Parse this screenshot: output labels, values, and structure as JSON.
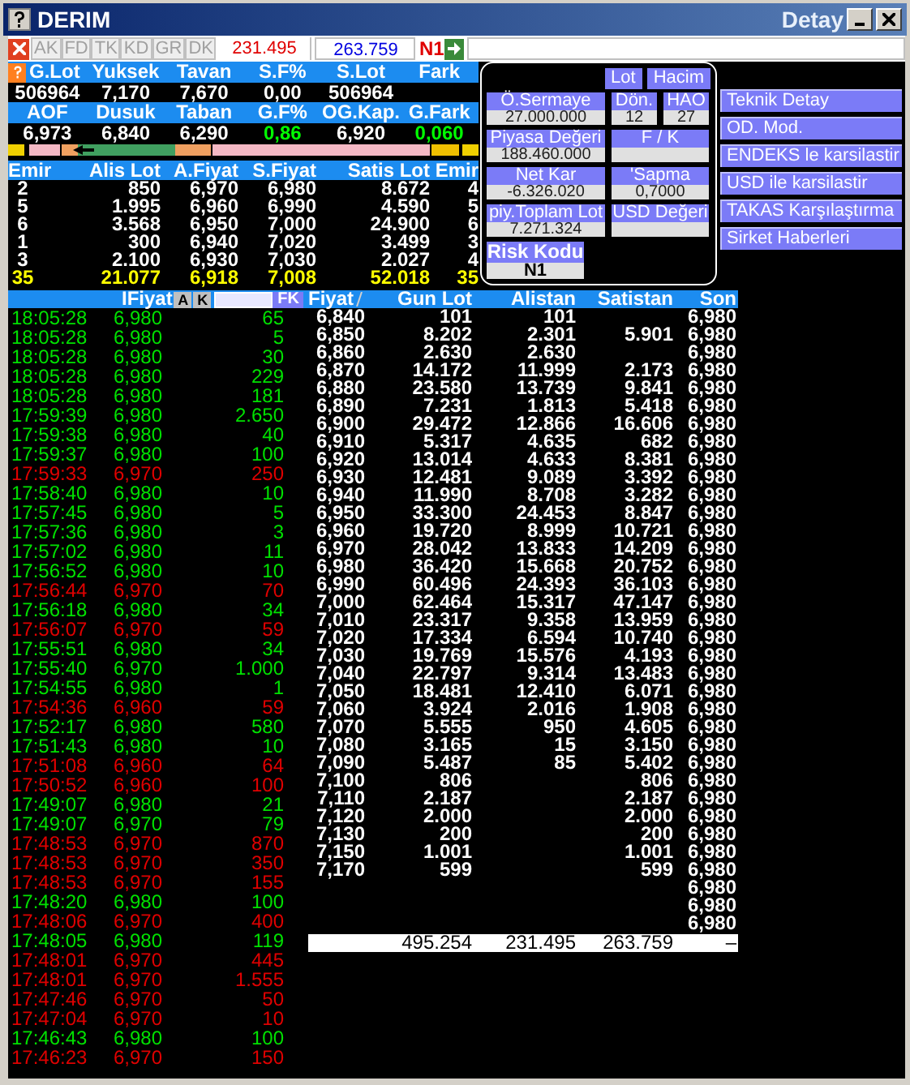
{
  "window": {
    "title": "DERIM",
    "subtitle": "Detay"
  },
  "toolbar": {
    "buttons": [
      {
        "label": "AK",
        "disabled": true
      },
      {
        "label": "FD",
        "disabled": true
      },
      {
        "label": "TK",
        "disabled": true
      },
      {
        "label": "KD",
        "disabled": true
      },
      {
        "label": "GR",
        "disabled": true
      },
      {
        "label": "DK",
        "disabled": true
      }
    ],
    "buy_total": "231.495",
    "sell_total": "263.759",
    "risk": "N1"
  },
  "stats_top": [
    {
      "label": "G.Lot",
      "value": "506964"
    },
    {
      "label": "Yuksek",
      "value": "7,170"
    },
    {
      "label": "Tavan",
      "value": "7,670"
    },
    {
      "label": "S.F%",
      "value": "0,00"
    },
    {
      "label": "S.Lot",
      "value": "506964"
    },
    {
      "label": "Fark"
    }
  ],
  "stats_bottom": [
    {
      "label": "AOF",
      "value": "6,973"
    },
    {
      "label": "Dusuk",
      "value": "6,840"
    },
    {
      "label": "Taban",
      "value": "6,290"
    },
    {
      "label": "G.F%",
      "value": "0,86",
      "color": "#00ff00"
    },
    {
      "label": "OG.Kap.",
      "value": "6,920"
    },
    {
      "label": "G.Fark",
      "value": "0,060",
      "color": "#00ff00"
    }
  ],
  "depth": {
    "columns": [
      "Emir",
      "Alis Lot",
      "A.Fiyat",
      "S.Fiyat",
      "Satis Lot",
      "Emir"
    ],
    "rows": [
      [
        "2",
        "850",
        "6,970",
        "6,980",
        "8.672",
        "4"
      ],
      [
        "5",
        "1.995",
        "6,960",
        "6,990",
        "4.590",
        "5"
      ],
      [
        "6",
        "3.568",
        "6,950",
        "7,000",
        "24.900",
        "6"
      ],
      [
        "1",
        "300",
        "6,940",
        "7,020",
        "3.499",
        "3"
      ],
      [
        "3",
        "2.100",
        "6,930",
        "7,030",
        "2.027",
        "4"
      ]
    ],
    "totals": [
      "35",
      "21.077",
      "6,918",
      "7,008",
      "52.018",
      "35"
    ]
  },
  "detail": {
    "toggles": [
      "Lot",
      "Hacim"
    ],
    "rows": [
      [
        {
          "label": "Ö.Sermaye",
          "value": "27.000.000"
        },
        {
          "label": "Dön.",
          "value": "12"
        },
        {
          "label": "HAO",
          "value": "27"
        }
      ],
      [
        {
          "label": "Piyasa Değeri",
          "value": "188.460.000"
        },
        {
          "label": "F / K"
        }
      ],
      [
        {
          "label": "Net Kar",
          "value": "-6.326.020"
        },
        {
          "label": "'Sapma",
          "value": "0,7000"
        }
      ],
      [
        {
          "label": "piy.Toplam Lot",
          "value": "7.271.324"
        },
        {
          "label": "USD Değeri"
        }
      ]
    ],
    "risk": {
      "label": "Risk Kodu",
      "value": "N1"
    }
  },
  "links": [
    "Teknik Detay",
    "OD. Mod.",
    "ENDEKS le karsilastir",
    "USD ile karsilastir",
    "TAKAS Karşılaştırma",
    "Sirket Haberleri"
  ],
  "trades": {
    "header": "IFiyat",
    "buttons": [
      "A",
      "K"
    ],
    "filter_button": "FK",
    "rows": [
      {
        "time": "18:05:28",
        "price": "6,980",
        "lot": "65",
        "color": "#00e000"
      },
      {
        "time": "18:05:28",
        "price": "6,980",
        "lot": "5",
        "color": "#00e000"
      },
      {
        "time": "18:05:28",
        "price": "6,980",
        "lot": "30",
        "color": "#00e000"
      },
      {
        "time": "18:05:28",
        "price": "6,980",
        "lot": "229",
        "color": "#00e000"
      },
      {
        "time": "18:05:28",
        "price": "6,980",
        "lot": "181",
        "color": "#00e000"
      },
      {
        "time": "17:59:39",
        "price": "6,980",
        "lot": "2.650",
        "color": "#00e000"
      },
      {
        "time": "17:59:38",
        "price": "6,980",
        "lot": "40",
        "color": "#00e000"
      },
      {
        "time": "17:59:37",
        "price": "6,980",
        "lot": "100",
        "color": "#00e000"
      },
      {
        "time": "17:59:33",
        "price": "6,970",
        "lot": "250",
        "color": "#e00000"
      },
      {
        "time": "17:58:40",
        "price": "6,980",
        "lot": "10",
        "color": "#00e000"
      },
      {
        "time": "17:57:45",
        "price": "6,980",
        "lot": "5",
        "color": "#00e000"
      },
      {
        "time": "17:57:36",
        "price": "6,980",
        "lot": "3",
        "color": "#00e000"
      },
      {
        "time": "17:57:02",
        "price": "6,980",
        "lot": "11",
        "color": "#00e000"
      },
      {
        "time": "17:56:52",
        "price": "6,980",
        "lot": "10",
        "color": "#00e000"
      },
      {
        "time": "17:56:44",
        "price": "6,970",
        "lot": "70",
        "color": "#e00000"
      },
      {
        "time": "17:56:18",
        "price": "6,980",
        "lot": "34",
        "color": "#00e000"
      },
      {
        "time": "17:56:07",
        "price": "6,970",
        "lot": "59",
        "color": "#e00000"
      },
      {
        "time": "17:55:51",
        "price": "6,980",
        "lot": "34",
        "color": "#00e000"
      },
      {
        "time": "17:55:40",
        "price": "6,970",
        "lot": "1.000",
        "color": "#00e000"
      },
      {
        "time": "17:54:55",
        "price": "6,980",
        "lot": "1",
        "color": "#00e000"
      },
      {
        "time": "17:54:36",
        "price": "6,960",
        "lot": "59",
        "color": "#e00000"
      },
      {
        "time": "17:52:17",
        "price": "6,980",
        "lot": "580",
        "color": "#00e000"
      },
      {
        "time": "17:51:43",
        "price": "6,980",
        "lot": "10",
        "color": "#00e000"
      },
      {
        "time": "17:51:08",
        "price": "6,960",
        "lot": "64",
        "color": "#e00000"
      },
      {
        "time": "17:50:52",
        "price": "6,960",
        "lot": "100",
        "color": "#e00000"
      },
      {
        "time": "17:49:07",
        "price": "6,980",
        "lot": "21",
        "color": "#00e000"
      },
      {
        "time": "17:49:07",
        "price": "6,970",
        "lot": "79",
        "color": "#00e000"
      },
      {
        "time": "17:48:53",
        "price": "6,970",
        "lot": "870",
        "color": "#e00000"
      },
      {
        "time": "17:48:53",
        "price": "6,970",
        "lot": "350",
        "color": "#e00000"
      },
      {
        "time": "17:48:53",
        "price": "6,970",
        "lot": "155",
        "color": "#e00000"
      },
      {
        "time": "17:48:20",
        "price": "6,980",
        "lot": "100",
        "color": "#00e000"
      },
      {
        "time": "17:48:06",
        "price": "6,970",
        "lot": "400",
        "color": "#e00000"
      },
      {
        "time": "17:48:05",
        "price": "6,980",
        "lot": "119",
        "color": "#00e000"
      },
      {
        "time": "17:48:01",
        "price": "6,970",
        "lot": "445",
        "color": "#e00000"
      },
      {
        "time": "17:48:01",
        "price": "6,970",
        "lot": "1.555",
        "color": "#e00000"
      },
      {
        "time": "17:47:46",
        "price": "6,970",
        "lot": "50",
        "color": "#e00000"
      },
      {
        "time": "17:47:04",
        "price": "6,970",
        "lot": "10",
        "color": "#e00000"
      },
      {
        "time": "17:46:43",
        "price": "6,980",
        "lot": "100",
        "color": "#00e000"
      },
      {
        "time": "17:46:23",
        "price": "6,970",
        "lot": "150",
        "color": "#e00000"
      }
    ]
  },
  "price_table": {
    "columns": [
      "Fiyat",
      "Gun Lot",
      "Alistan",
      "Satistan",
      "Son"
    ],
    "rows": [
      {
        "fiyat": "6,840",
        "gun_lot": "101",
        "alistan": "101",
        "son": "6,980"
      },
      {
        "fiyat": "6,850",
        "gun_lot": "8.202",
        "alistan": "2.301",
        "satistan": "5.901",
        "son": "6,980"
      },
      {
        "fiyat": "6,860",
        "gun_lot": "2.630",
        "alistan": "2.630",
        "son": "6,980"
      },
      {
        "fiyat": "6,870",
        "gun_lot": "14.172",
        "alistan": "11.999",
        "satistan": "2.173",
        "son": "6,980"
      },
      {
        "fiyat": "6,880",
        "gun_lot": "23.580",
        "alistan": "13.739",
        "satistan": "9.841",
        "son": "6,980"
      },
      {
        "fiyat": "6,890",
        "gun_lot": "7.231",
        "alistan": "1.813",
        "satistan": "5.418",
        "son": "6,980"
      },
      {
        "fiyat": "6,900",
        "gun_lot": "29.472",
        "alistan": "12.866",
        "satistan": "16.606",
        "son": "6,980"
      },
      {
        "fiyat": "6,910",
        "gun_lot": "5.317",
        "alistan": "4.635",
        "satistan": "682",
        "son": "6,980"
      },
      {
        "fiyat": "6,920",
        "gun_lot": "13.014",
        "alistan": "4.633",
        "satistan": "8.381",
        "son": "6,980"
      },
      {
        "fiyat": "6,930",
        "gun_lot": "12.481",
        "alistan": "9.089",
        "satistan": "3.392",
        "son": "6,980"
      },
      {
        "fiyat": "6,940",
        "gun_lot": "11.990",
        "alistan": "8.708",
        "satistan": "3.282",
        "son": "6,980"
      },
      {
        "fiyat": "6,950",
        "gun_lot": "33.300",
        "alistan": "24.453",
        "satistan": "8.847",
        "son": "6,980"
      },
      {
        "fiyat": "6,960",
        "gun_lot": "19.720",
        "alistan": "8.999",
        "satistan": "10.721",
        "son": "6,980"
      },
      {
        "fiyat": "6,970",
        "gun_lot": "28.042",
        "alistan": "13.833",
        "satistan": "14.209",
        "son": "6,980"
      },
      {
        "fiyat": "6,980",
        "gun_lot": "36.420",
        "alistan": "15.668",
        "satistan": "20.752",
        "son": "6,980"
      },
      {
        "fiyat": "6,990",
        "gun_lot": "60.496",
        "alistan": "24.393",
        "satistan": "36.103",
        "son": "6,980"
      },
      {
        "fiyat": "7,000",
        "gun_lot": "62.464",
        "alistan": "15.317",
        "satistan": "47.147",
        "son": "6,980"
      },
      {
        "fiyat": "7,010",
        "gun_lot": "23.317",
        "alistan": "9.358",
        "satistan": "13.959",
        "son": "6,980"
      },
      {
        "fiyat": "7,020",
        "gun_lot": "17.334",
        "alistan": "6.594",
        "satistan": "10.740",
        "son": "6,980"
      },
      {
        "fiyat": "7,030",
        "gun_lot": "19.769",
        "alistan": "15.576",
        "satistan": "4.193",
        "son": "6,980"
      },
      {
        "fiyat": "7,040",
        "gun_lot": "22.797",
        "alistan": "9.314",
        "satistan": "13.483",
        "son": "6,980"
      },
      {
        "fiyat": "7,050",
        "gun_lot": "18.481",
        "alistan": "12.410",
        "satistan": "6.071",
        "son": "6,980"
      },
      {
        "fiyat": "7,060",
        "gun_lot": "3.924",
        "alistan": "2.016",
        "satistan": "1.908",
        "son": "6,980"
      },
      {
        "fiyat": "7,070",
        "gun_lot": "5.555",
        "alistan": "950",
        "satistan": "4.605",
        "son": "6,980"
      },
      {
        "fiyat": "7,080",
        "gun_lot": "3.165",
        "alistan": "15",
        "satistan": "3.150",
        "son": "6,980"
      },
      {
        "fiyat": "7,090",
        "gun_lot": "5.487",
        "alistan": "85",
        "satistan": "5.402",
        "son": "6,980"
      },
      {
        "fiyat": "7,100",
        "gun_lot": "806",
        "satistan": "806",
        "son": "6,980"
      },
      {
        "fiyat": "7,110",
        "gun_lot": "2.187",
        "satistan": "2.187",
        "son": "6,980"
      },
      {
        "fiyat": "7,120",
        "gun_lot": "2.000",
        "satistan": "2.000",
        "son": "6,980"
      },
      {
        "fiyat": "7,130",
        "gun_lot": "200",
        "satistan": "200",
        "son": "6,980"
      },
      {
        "fiyat": "7,150",
        "gun_lot": "1.001",
        "satistan": "1.001",
        "son": "6,980"
      },
      {
        "fiyat": "7,170",
        "gun_lot": "599",
        "satistan": "599",
        "son": "6,980"
      },
      {
        "son": "6,980"
      },
      {
        "son": "6,980"
      },
      {
        "son": "6,980"
      }
    ],
    "totals": {
      "gun_lot": "495.254",
      "alistan": "231.495",
      "satistan": "263.759",
      "son": "–"
    }
  }
}
